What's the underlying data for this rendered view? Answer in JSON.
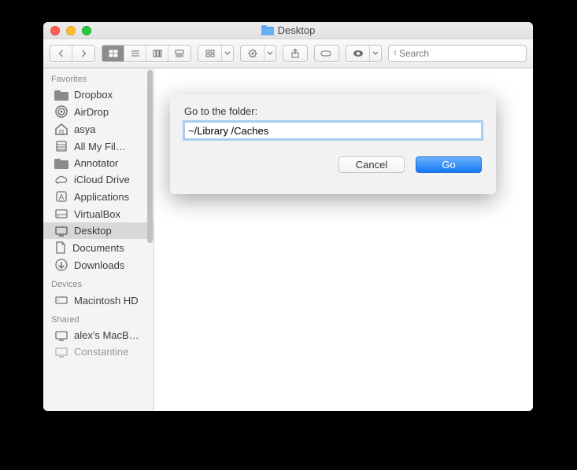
{
  "window": {
    "title": "Desktop"
  },
  "toolbar": {
    "search_placeholder": "Search"
  },
  "sidebar": {
    "sections": {
      "favorites": {
        "title": "Favorites",
        "items": [
          {
            "label": "Dropbox",
            "icon": "folder"
          },
          {
            "label": "AirDrop",
            "icon": "airdrop"
          },
          {
            "label": "asya",
            "icon": "home"
          },
          {
            "label": "All My Fil…",
            "icon": "allfiles"
          },
          {
            "label": "Annotator",
            "icon": "folder"
          },
          {
            "label": "iCloud Drive",
            "icon": "cloud"
          },
          {
            "label": "Applications",
            "icon": "app"
          },
          {
            "label": "VirtualBox",
            "icon": "disk"
          },
          {
            "label": "Desktop",
            "icon": "desktop",
            "selected": true
          },
          {
            "label": "Documents",
            "icon": "doc"
          },
          {
            "label": "Downloads",
            "icon": "downloads"
          }
        ]
      },
      "devices": {
        "title": "Devices",
        "items": [
          {
            "label": "Macintosh HD",
            "icon": "disk"
          }
        ]
      },
      "shared": {
        "title": "Shared",
        "items": [
          {
            "label": "alex's MacB…",
            "icon": "monitor"
          },
          {
            "label": "Constantine",
            "icon": "monitor"
          }
        ]
      }
    }
  },
  "dialog": {
    "label": "Go to the folder:",
    "value": "~/Library /Caches",
    "cancel": "Cancel",
    "go": "Go"
  }
}
